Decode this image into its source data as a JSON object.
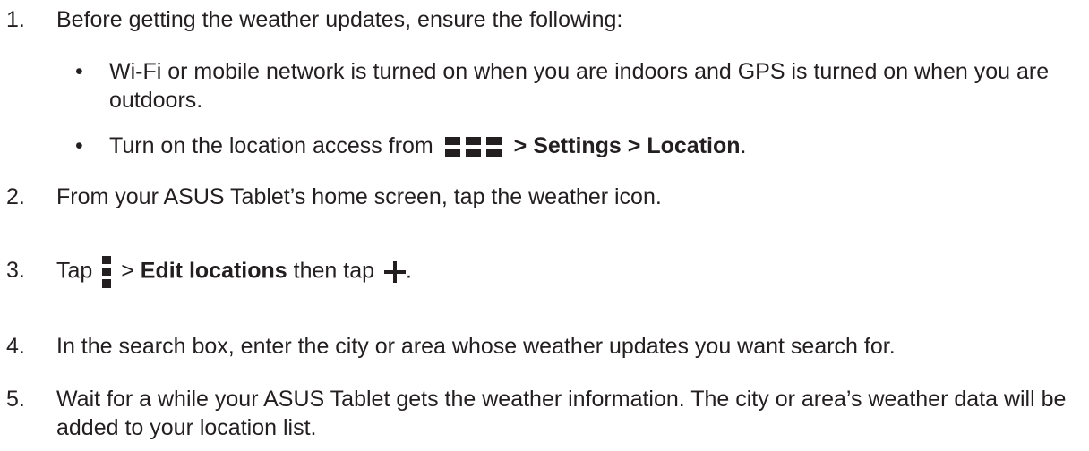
{
  "steps": [
    {
      "number": "1.",
      "text": "Before getting the weather updates, ensure the following:",
      "bullets": [
        {
          "text": "Wi-Fi or mobile network is turned on when you are indoors and GPS is turned on when you are outdoors."
        },
        {
          "prefix": "Turn on the location access from",
          "icon": "all-apps-grid-icon",
          "separator1": ">",
          "settings": "Settings",
          "separator2": ">",
          "location": "Location",
          "end": "."
        }
      ]
    },
    {
      "number": "2.",
      "text": "From your ASUS Tablet’s home screen, tap the weather icon."
    },
    {
      "number": "3.",
      "prefix": "Tap",
      "icon1": "overflow-menu-icon",
      "separator": ">",
      "bold": "Edit locations",
      "middle": "then tap",
      "icon2": "add-plus-icon",
      "end": "."
    },
    {
      "number": "4.",
      "text": "In the search box, enter the city or area whose weather updates you want search for."
    },
    {
      "number": "5.",
      "text": "Wait for a while your ASUS Tablet gets the weather information. The city or area’s weather data will be added to your location list."
    }
  ],
  "colors": {
    "text": "#231f20",
    "icon": "#231f20"
  }
}
